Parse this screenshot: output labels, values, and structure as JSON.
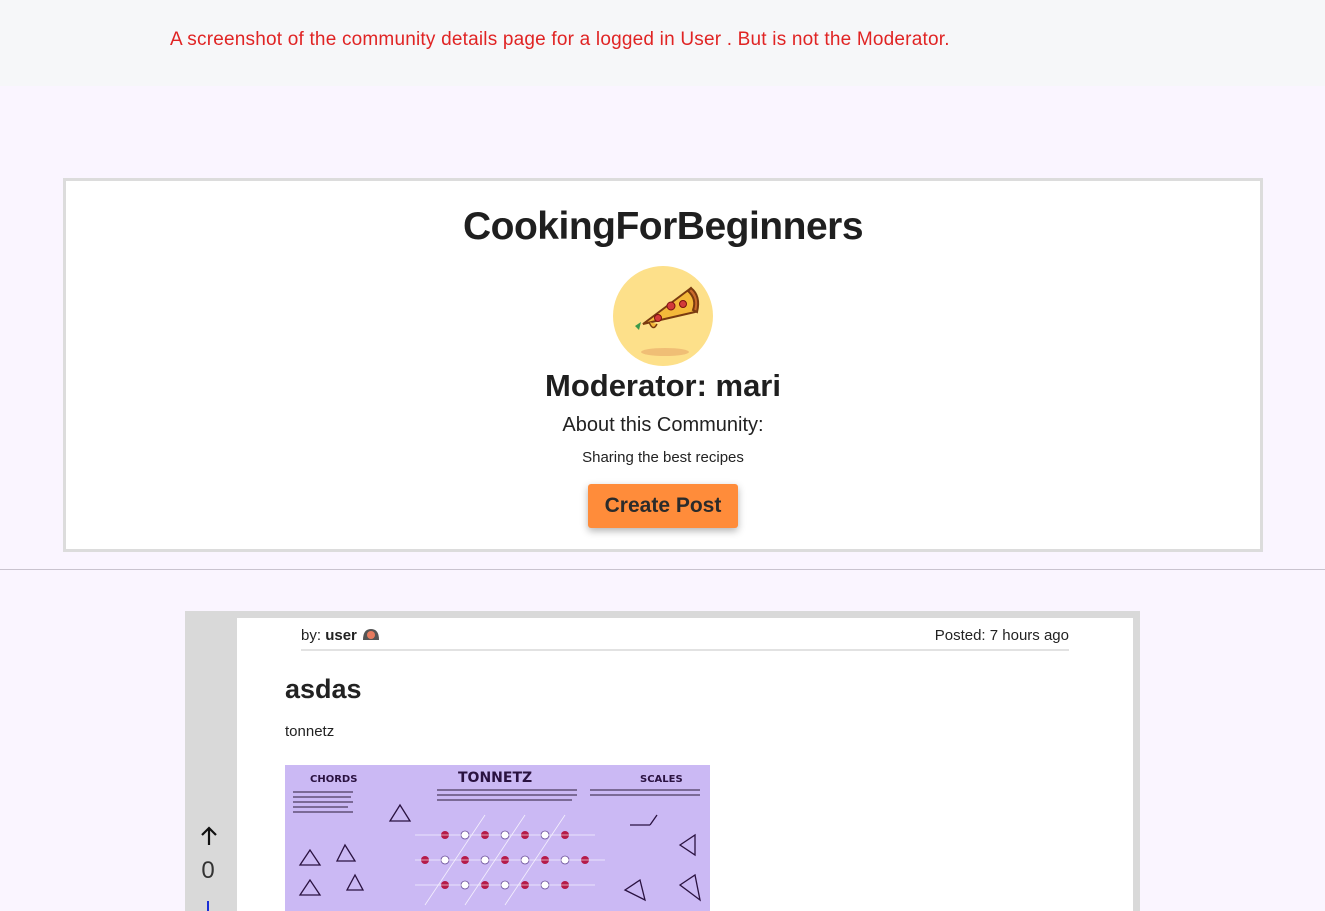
{
  "annotation": {
    "text": "A  screenshot of the community details page for a logged in User .  But is not the Moderator."
  },
  "community": {
    "name": "CookingForBeginners",
    "moderator_label": "Moderator: mari",
    "about_heading": "About this Community:",
    "about_text": "Sharing the best recipes",
    "create_post_label": "Create Post"
  },
  "post": {
    "by_prefix": "by:",
    "author": "user",
    "posted": "Posted: 7 hours ago",
    "title": "asdas",
    "body": "tonnetz",
    "vote_count": "0",
    "image": {
      "chords_label": "CHORDS",
      "title_label": "TONNETZ",
      "scales_label": "SCALES"
    }
  },
  "icons": {
    "upvote": "arrow-up-icon",
    "downvote": "arrow-down-icon",
    "community_avatar": "pizza-icon",
    "author_avatar": "user-avatar-icon"
  },
  "colors": {
    "annotation": "#e02424",
    "accent_button": "#ff8c3a",
    "page_background": "#faf5ff"
  }
}
